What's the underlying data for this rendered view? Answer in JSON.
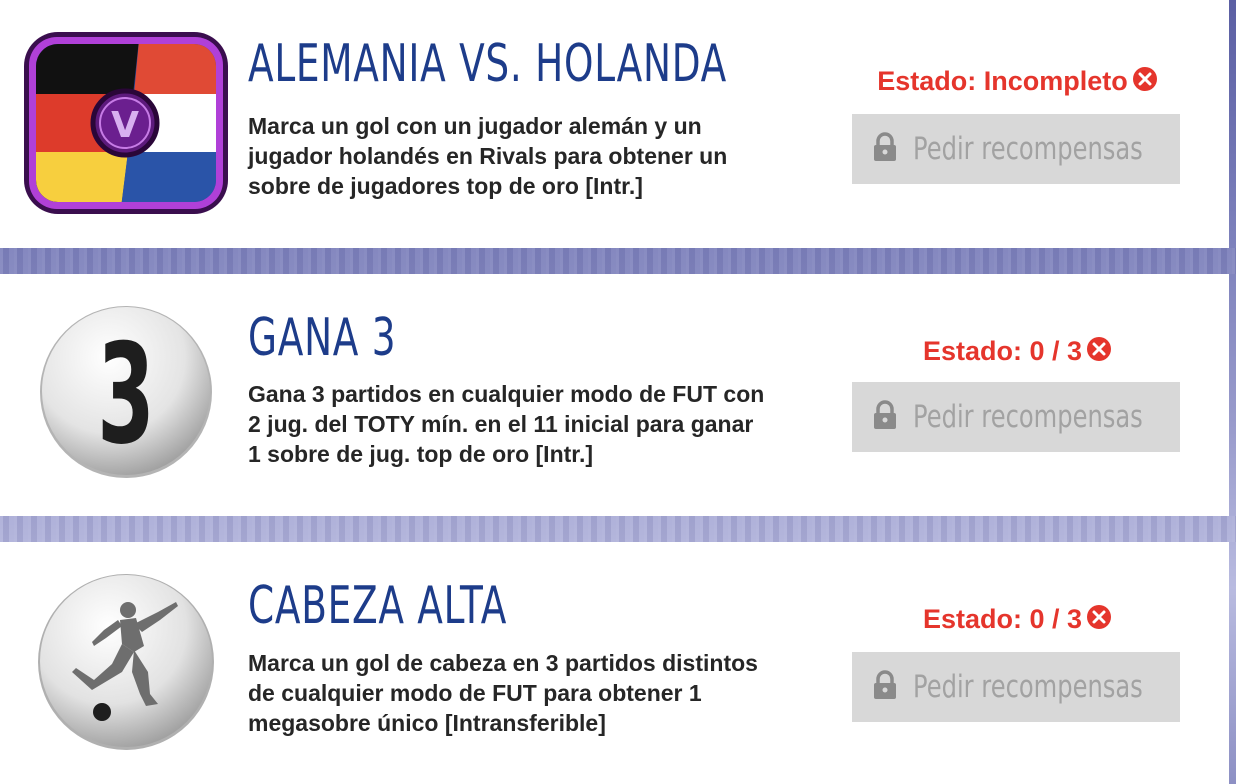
{
  "objectives": [
    {
      "title": "ALEMANIA VS. HOLANDA",
      "description": "Marca un gol con un jugador alemán y un jugador holandés en Rivals para obtener un sobre de jugadores top de oro [Intr.]",
      "status": "Estado: Incompleto",
      "button_label": "Pedir recompensas",
      "badge_icon": "germany-vs-netherlands-flag-icon",
      "badge_text": "V"
    },
    {
      "title": "GANA 3",
      "description": "Gana 3 partidos en cualquier modo de FUT con 2 jug. del TOTY mín. en el 11 inicial para ganar 1 sobre de jug. top de oro [Intr.]",
      "status": "Estado: 0 / 3",
      "button_label": "Pedir recompensas",
      "badge_icon": "number-three-icon",
      "badge_text": "3"
    },
    {
      "title": "CABEZA ALTA",
      "description": "Marca un gol de cabeza en 3 partidos distintos de cualquier modo de FUT para obtener 1 megasobre único [Intransferible]",
      "status": "Estado: 0 / 3",
      "button_label": "Pedir recompensas",
      "badge_icon": "soccer-player-kicking-icon"
    }
  ],
  "colors": {
    "title": "#1d3c8a",
    "status": "#e5352c",
    "button_bg": "#d8d8d8",
    "button_text": "#a2a2a2"
  }
}
